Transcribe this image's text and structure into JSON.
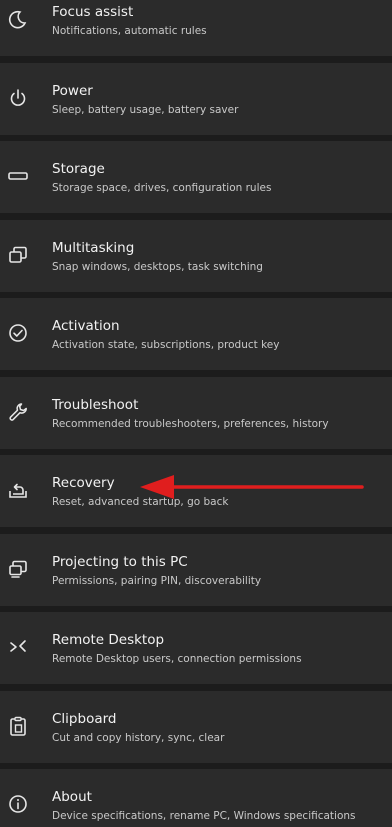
{
  "accent_color": "#e01e1e",
  "settings_items": [
    {
      "title": "Focus assist",
      "subtitle": "Notifications, automatic rules",
      "icon": "moon-icon"
    },
    {
      "title": "Power",
      "subtitle": "Sleep, battery usage, battery saver",
      "icon": "power-icon"
    },
    {
      "title": "Storage",
      "subtitle": "Storage space, drives, configuration rules",
      "icon": "storage-icon"
    },
    {
      "title": "Multitasking",
      "subtitle": "Snap windows, desktops, task switching",
      "icon": "multitasking-icon"
    },
    {
      "title": "Activation",
      "subtitle": "Activation state, subscriptions, product key",
      "icon": "activation-check-icon"
    },
    {
      "title": "Troubleshoot",
      "subtitle": "Recommended troubleshooters, preferences, history",
      "icon": "wrench-icon"
    },
    {
      "title": "Recovery",
      "subtitle": "Reset, advanced startup, go back",
      "icon": "recovery-icon"
    },
    {
      "title": "Projecting to this PC",
      "subtitle": "Permissions, pairing PIN, discoverability",
      "icon": "projecting-icon"
    },
    {
      "title": "Remote Desktop",
      "subtitle": "Remote Desktop users, connection permissions",
      "icon": "remote-desktop-icon"
    },
    {
      "title": "Clipboard",
      "subtitle": "Cut and copy history, sync, clear",
      "icon": "clipboard-icon"
    },
    {
      "title": "About",
      "subtitle": "Device specifications, rename PC, Windows specifications",
      "icon": "info-icon"
    }
  ]
}
